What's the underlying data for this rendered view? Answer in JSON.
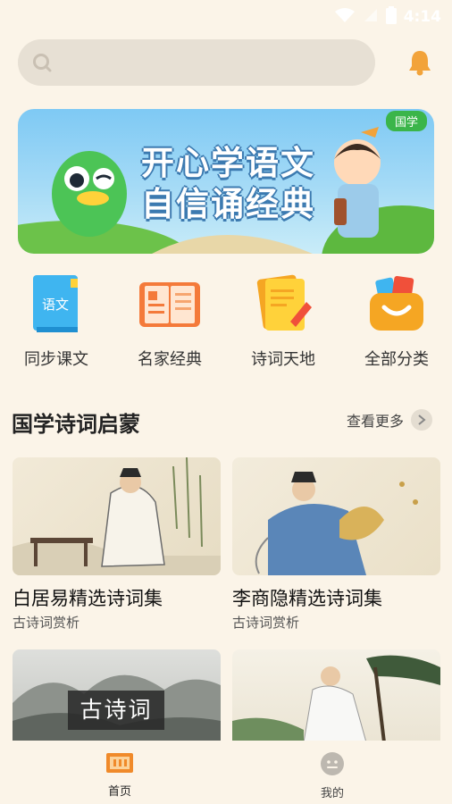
{
  "status_bar": {
    "time": "4:14"
  },
  "search": {
    "placeholder": ""
  },
  "banner": {
    "tag": "国学",
    "title_line1": "开心学语文",
    "title_line2": "自信诵经典"
  },
  "categories": [
    {
      "label": "同步课文",
      "icon": "textbook-icon",
      "icon_text": "语文"
    },
    {
      "label": "名家经典",
      "icon": "open-book-icon"
    },
    {
      "label": "诗词天地",
      "icon": "notes-icon"
    },
    {
      "label": "全部分类",
      "icon": "basket-icon"
    }
  ],
  "section": {
    "title": "国学诗词启蒙",
    "see_more": "查看更多"
  },
  "cards": [
    {
      "title": "白居易精选诗词集",
      "subtitle": "古诗词赏析"
    },
    {
      "title": "李商隐精选诗词集",
      "subtitle": "古诗词赏析"
    },
    {
      "overlay": "古诗词"
    },
    {}
  ],
  "bottom_nav": [
    {
      "label": "首页",
      "icon": "home-icon",
      "active": true
    },
    {
      "label": "我的",
      "icon": "profile-icon",
      "active": false
    }
  ],
  "colors": {
    "accent": "#f0a53a",
    "background": "#fbf4e8",
    "banner_tag": "#3bb54a"
  }
}
